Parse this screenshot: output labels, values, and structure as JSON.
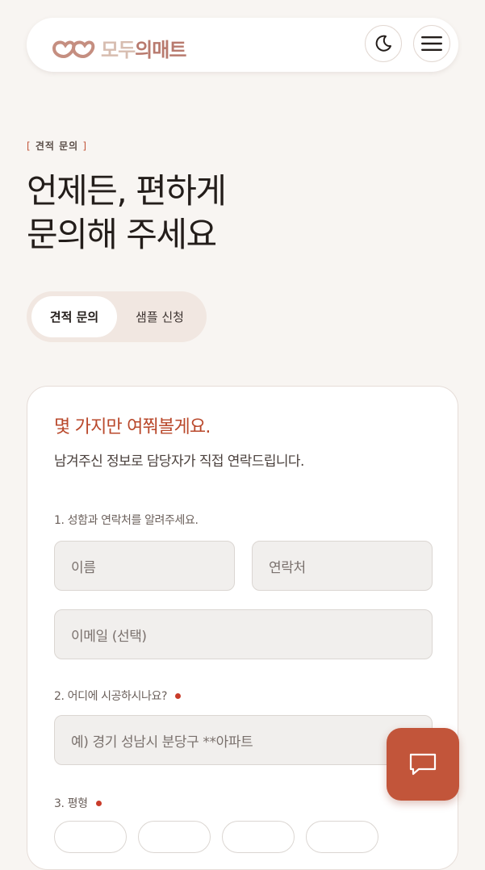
{
  "header": {
    "logo_part1": "모두",
    "logo_part2": "의매트",
    "icons": {
      "logo": "heart-logo-icon",
      "theme": "moon-icon",
      "menu": "hamburger-icon"
    }
  },
  "eyebrow": {
    "open": "[",
    "text": "견적 문의",
    "close": "]"
  },
  "hero": {
    "line1": "언제든, 편하게",
    "line2": "문의해 주세요"
  },
  "tabs": [
    {
      "label": "견적 문의",
      "active": true
    },
    {
      "label": "샘플 신청",
      "active": false
    }
  ],
  "form": {
    "title": "몇 가지만 여쭤볼게요.",
    "subtitle": "남겨주신 정보로 담당자가 직접 연락드립니다.",
    "q1": "1. 성함과 연락처를 알려주세요.",
    "name_placeholder": "이름",
    "phone_placeholder": "연락처",
    "email_placeholder": "이메일 (선택)",
    "q2": "2. 어디에 시공하시나요?",
    "address_placeholder": "예) 경기 성남시 분당구 **아파트",
    "q3": "3. 평형"
  },
  "chat": {
    "icon": "chat-bubble-icon"
  },
  "colors": {
    "accent": "#c2553a",
    "background": "#f8f5f2",
    "title_accent": "#b9482b"
  }
}
